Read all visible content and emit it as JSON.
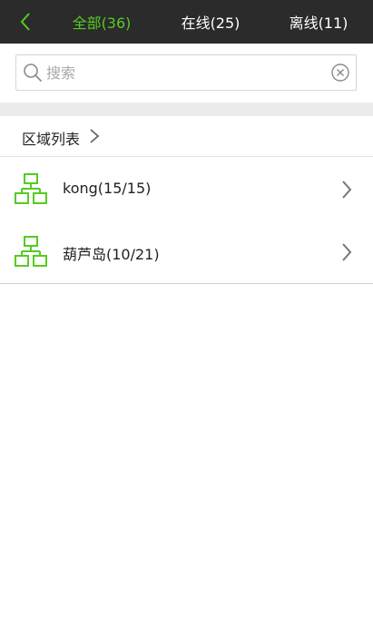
{
  "colors": {
    "accent": "#55cc22",
    "topbar": "#2b2b2b",
    "tab_text": "#ffffff"
  },
  "topbar": {
    "back_icon": "chevron-left-icon",
    "tabs": [
      {
        "label": "全部(36)",
        "active": true
      },
      {
        "label": "在线(25)",
        "active": false
      },
      {
        "label": "离线(11)",
        "active": false
      }
    ]
  },
  "search": {
    "placeholder": "搜索",
    "value": "",
    "search_icon": "search-icon",
    "clear_icon": "clear-icon"
  },
  "region_list": {
    "title": "区域列表",
    "chevron_icon": "chevron-right-icon"
  },
  "areas": [
    {
      "label": "kong(15/15)",
      "icon": "network-tree-icon"
    },
    {
      "label": "葫芦岛(10/21)",
      "icon": "network-tree-icon"
    }
  ]
}
